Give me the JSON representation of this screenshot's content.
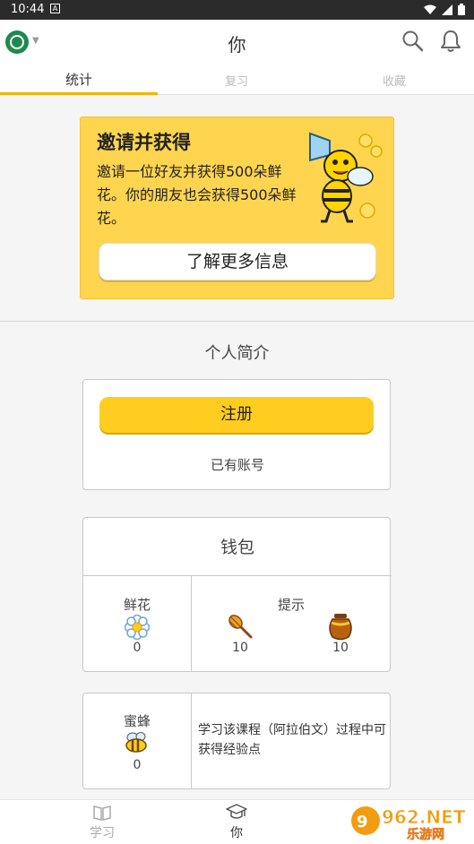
{
  "status": {
    "time": "10:44",
    "app_indicator": "A"
  },
  "header": {
    "title": "你"
  },
  "tabs": [
    {
      "label": "统计",
      "active": true
    },
    {
      "label": "复习",
      "active": false
    },
    {
      "label": "收藏",
      "active": false
    }
  ],
  "invite": {
    "heading": "邀请并获得",
    "description": "邀请一位好友并获得500朵鲜花。你的朋友也会获得500朵鲜花。",
    "button_label": "了解更多信息"
  },
  "profile": {
    "title": "个人简介",
    "register_label": "注册",
    "have_account_label": "已有账号"
  },
  "wallet": {
    "title": "钱包",
    "flowers": {
      "label": "鲜花",
      "value": "0"
    },
    "hints": {
      "label": "提示",
      "dipper_value": "10",
      "pot_value": "10"
    }
  },
  "bees": {
    "label": "蜜蜂",
    "value": "0",
    "description": "学习该课程（阿拉伯文）过程中可获得经验点"
  },
  "bottom_nav": [
    {
      "label": "学习",
      "active": false
    },
    {
      "label": "你",
      "active": true
    }
  ],
  "watermark": {
    "text": "962.NET",
    "subtext": "乐游网"
  },
  "colors": {
    "accent": "#ffcd1f",
    "banner": "#ffd54f",
    "tab_indicator": "#f4b400",
    "logo": "#1e8a4f"
  }
}
